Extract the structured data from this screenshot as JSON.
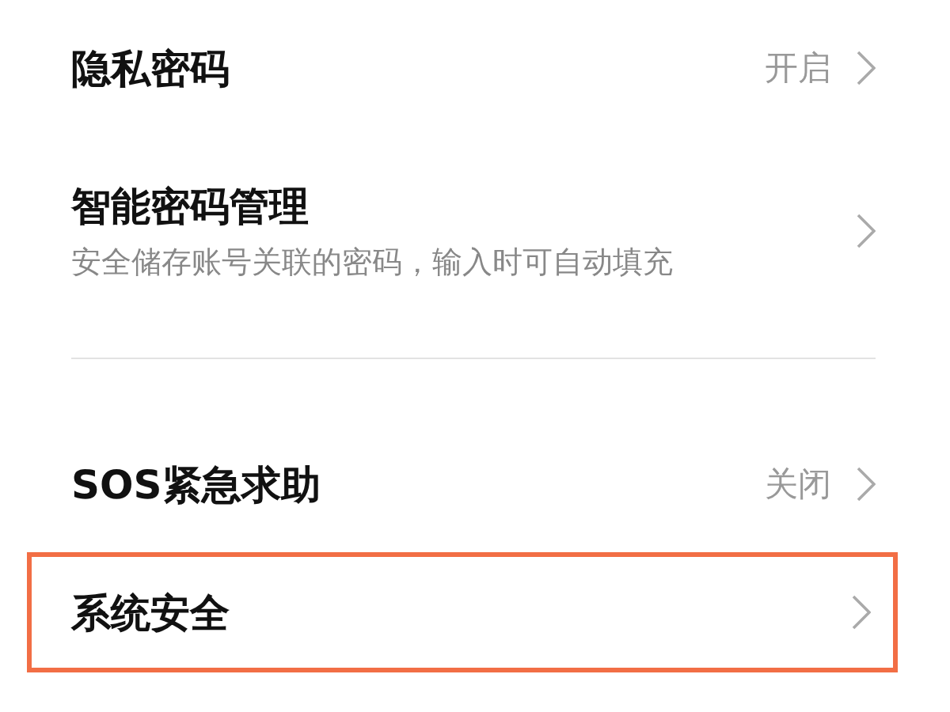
{
  "settings": [
    {
      "kind": "value",
      "title": "隐私密码",
      "value": "开启",
      "highlighted": false
    },
    {
      "kind": "subtitle",
      "title": "智能密码管理",
      "subtitle": "安全储存账号关联的密码，输入时可自动填充",
      "highlighted": false
    },
    {
      "kind": "divider"
    },
    {
      "kind": "value",
      "title": "SOS紧急求助",
      "value": "关闭",
      "highlighted": false
    },
    {
      "kind": "plain",
      "title": "系统安全",
      "highlighted": true
    }
  ]
}
